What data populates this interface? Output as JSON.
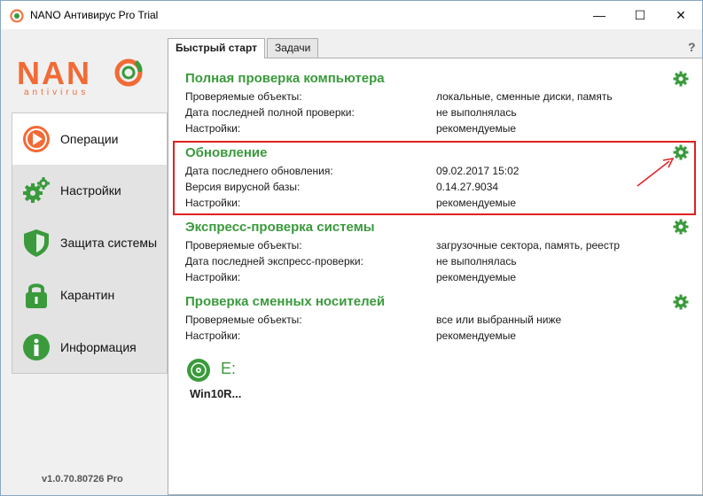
{
  "window": {
    "title": "NANO Антивирус Pro Trial",
    "minimize": "—",
    "maximize": "☐",
    "close": "✕"
  },
  "logo": {
    "brand": "NANO",
    "sub": "antivirus"
  },
  "nav": [
    {
      "label": "Операции",
      "icon": "play-circle-icon"
    },
    {
      "label": "Настройки",
      "icon": "gears-icon"
    },
    {
      "label": "Защита системы",
      "icon": "shield-icon"
    },
    {
      "label": "Карантин",
      "icon": "lock-icon"
    },
    {
      "label": "Информация",
      "icon": "info-icon"
    }
  ],
  "version": "v1.0.70.80726 Pro",
  "tabs": [
    "Быстрый старт",
    "Задачи"
  ],
  "help": "?",
  "sections": [
    {
      "title": "Полная проверка компьютера",
      "rows": [
        {
          "k": "Проверяемые объекты:",
          "v": "локальные, сменные диски, память"
        },
        {
          "k": "Дата последней полной проверки:",
          "v": "не выполнялась"
        },
        {
          "k": "Настройки:",
          "v": "рекомендуемые"
        }
      ]
    },
    {
      "title": "Обновление",
      "rows": [
        {
          "k": "Дата последнего обновления:",
          "v": "09.02.2017 15:02"
        },
        {
          "k": "Версия вирусной базы:",
          "v": "0.14.27.9034"
        },
        {
          "k": "Настройки:",
          "v": "рекомендуемые"
        }
      ]
    },
    {
      "title": "Экспресс-проверка системы",
      "rows": [
        {
          "k": "Проверяемые объекты:",
          "v": "загрузочные сектора, память, реестр"
        },
        {
          "k": "Дата последней экспресс-проверки:",
          "v": "не выполнялась"
        },
        {
          "k": "Настройки:",
          "v": "рекомендуемые"
        }
      ]
    },
    {
      "title": "Проверка сменных носителей",
      "rows": [
        {
          "k": "Проверяемые объекты:",
          "v": "все или выбранный ниже"
        },
        {
          "k": "Настройки:",
          "v": "рекомендуемые"
        }
      ]
    }
  ],
  "drive": {
    "letter": "E:",
    "name": "Win10R..."
  },
  "colors": {
    "accent_green": "#3a9a3c",
    "brand_orange": "#f26a35",
    "highlight_red": "#e02020"
  }
}
